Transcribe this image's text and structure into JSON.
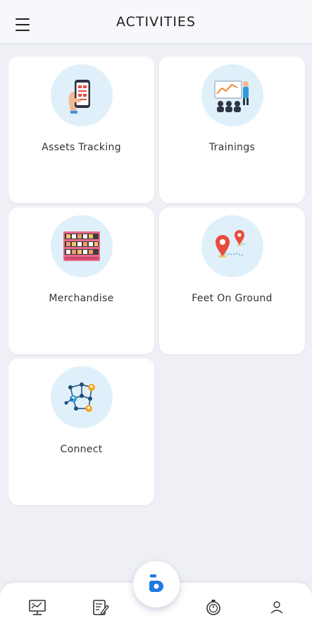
{
  "header": {
    "title": "ACTIVITIES",
    "menu_icon": "hamburger-menu-icon"
  },
  "activities": [
    {
      "label": "Assets Tracking",
      "icon": "phone-scanner-icon"
    },
    {
      "label": "Trainings",
      "icon": "presentation-training-icon"
    },
    {
      "label": "Merchandise",
      "icon": "store-shelf-icon"
    },
    {
      "label": "Feet On Ground",
      "icon": "map-pins-route-icon"
    },
    {
      "label": "Connect",
      "icon": "network-people-icon"
    }
  ],
  "bottom_nav": {
    "items": [
      {
        "icon": "dashboard-monitor-icon"
      },
      {
        "icon": "notes-edit-icon"
      },
      {
        "icon": "home-logo-icon"
      },
      {
        "icon": "timer-icon"
      },
      {
        "icon": "profile-user-icon"
      }
    ]
  },
  "colors": {
    "background": "#eef0f5",
    "card": "#ffffff",
    "icon_circle": "#dff0fb",
    "accent": "#1f7ae0"
  }
}
